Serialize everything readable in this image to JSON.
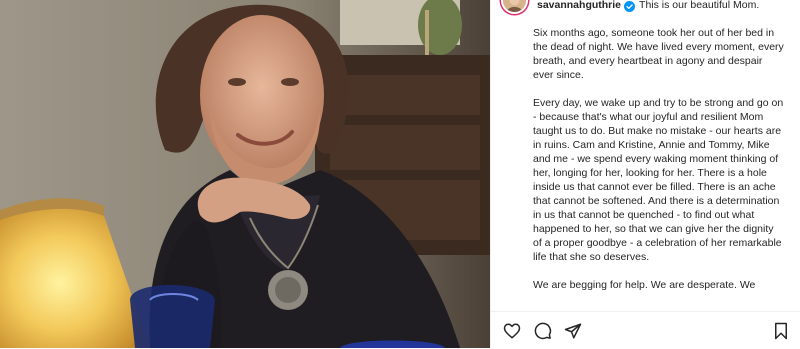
{
  "post": {
    "username": "savannahguthrie",
    "caption_first": "This is our beautiful Mom.",
    "paragraphs": [
      "Six months ago, someone took her out of her bed in the dead of night. We have lived every moment, every breath, and every heartbeat in agony and despair ever since.",
      "Every day, we wake up and try to be strong and go on - because that's what our joyful and resilient Mom taught us to do. But make no mistake - our hearts are in ruins. Cam and Kristine, Annie and Tommy, Mike and me - we spend every waking moment thinking of her, longing for her, looking for her. There is a hole inside us that cannot ever be filled. There is an ache that cannot be softened. And there is a determination in us that cannot be quenched - to find out what happened to her, so that we can give her the dignity of a proper goodbye - a celebration of her remarkable life that she so deserves.",
      "We are begging for help. We are desperate. We"
    ],
    "icons": {
      "verified": "verified-badge-icon",
      "like": "heart-icon",
      "comment": "comment-icon",
      "share": "paper-plane-icon",
      "save": "bookmark-icon"
    },
    "colors": {
      "text": "#262626",
      "verified": "#0095f6",
      "ring": "#e1306c"
    }
  }
}
